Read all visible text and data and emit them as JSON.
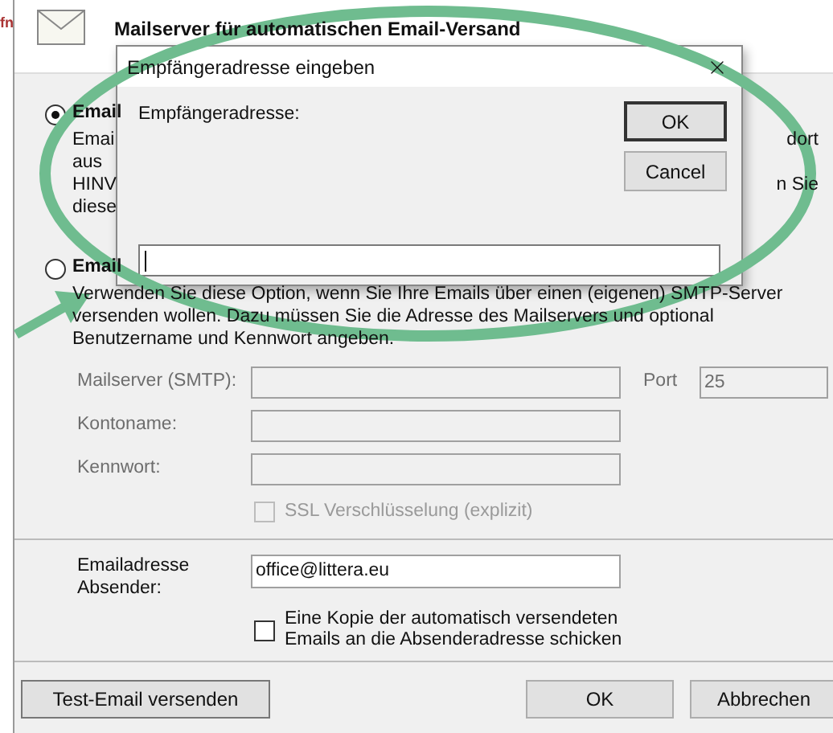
{
  "background_fragment": "fn",
  "header": {
    "title": "Mailserver für automatischen Email-Versand"
  },
  "options": [
    {
      "label": "Email",
      "selected": true,
      "lines": [
        {
          "left": "Emai",
          "right": "dort"
        },
        {
          "left": "aus"
        },
        {
          "left": "HINV",
          "right": "n Sie"
        },
        {
          "left": "diese"
        }
      ]
    },
    {
      "label": "Email",
      "selected": false,
      "lines": [
        {
          "left": "Verwenden Sie diese Option, wenn Sie Ihre Emails über einen (eigenen) SMTP-Server"
        },
        {
          "left": "versenden wollen. Dazu müssen Sie die Adresse des Mailservers und optional"
        },
        {
          "left": "Benutzername und Kennwort angeben."
        }
      ]
    }
  ],
  "fields": [
    {
      "label": "Mailserver (SMTP):",
      "disabled": true
    },
    {
      "label": "Kontoname:",
      "disabled": true
    },
    {
      "label": "Kennwort:",
      "disabled": true
    }
  ],
  "port": {
    "label": "Port",
    "value": "25",
    "disabled": true
  },
  "ssl": {
    "label": "SSL Verschlüsselung (explizit)",
    "checked": false,
    "disabled": true
  },
  "sender": {
    "label": "Emailadresse Absender:",
    "value": "office@littera.eu"
  },
  "copy": {
    "label": "Eine Kopie der automatisch versendeten Emails an die Absenderadresse schicken",
    "checked": false
  },
  "buttons": {
    "test": "Test-Email versenden",
    "ok": "OK",
    "cancel": "Abbrechen"
  },
  "modal": {
    "title": "Empfängeradresse eingeben",
    "label": "Empfängeradresse:",
    "buttons": [
      "OK",
      "Cancel"
    ]
  }
}
